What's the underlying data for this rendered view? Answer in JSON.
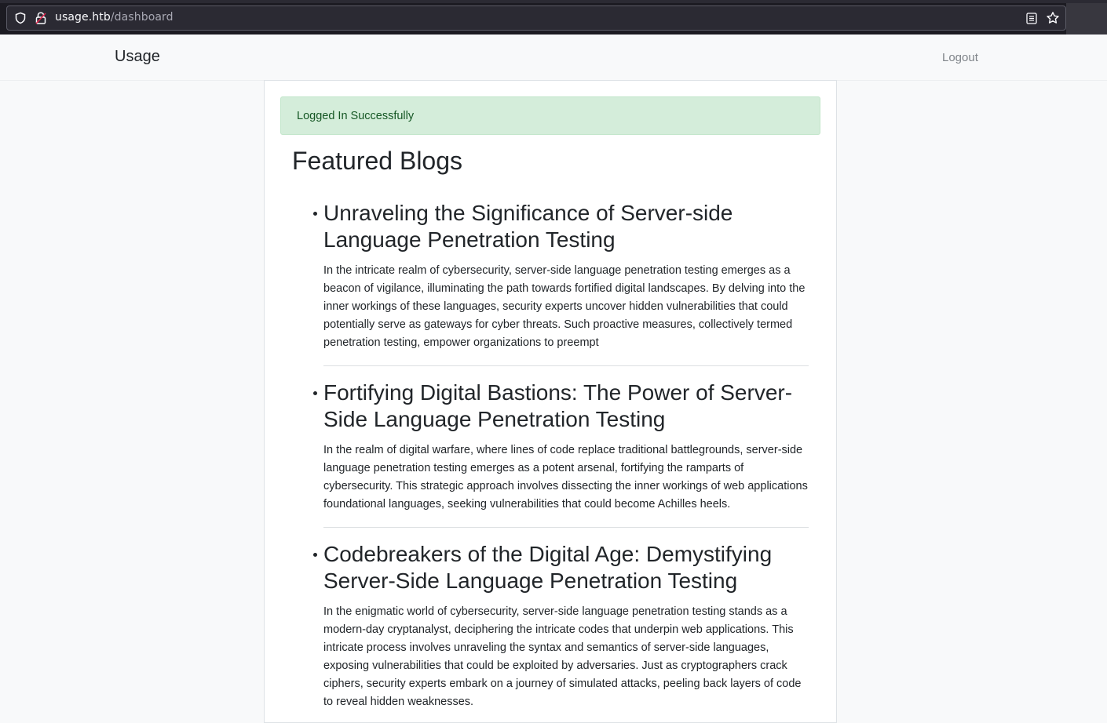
{
  "browser": {
    "url_host": "usage.htb",
    "url_path": "/dashboard"
  },
  "navbar": {
    "brand": "Usage",
    "logout_label": "Logout"
  },
  "alert": {
    "message": "Logged In Successfully"
  },
  "main": {
    "title": "Featured Blogs",
    "blogs": [
      {
        "title": "Unraveling the Significance of Server-side Language Penetration Testing",
        "body": "In the intricate realm of cybersecurity, server-side language penetration testing emerges as a beacon of vigilance, illuminating the path towards fortified digital landscapes. By delving into the inner workings of these languages, security experts uncover hidden vulnerabilities that could potentially serve as gateways for cyber threats. Such proactive measures, collectively termed penetration testing, empower organizations to preempt"
      },
      {
        "title": "Fortifying Digital Bastions: The Power of Server-Side Language Penetration Testing",
        "body": "In the realm of digital warfare, where lines of code replace traditional battlegrounds, server-side language penetration testing emerges as a potent arsenal, fortifying the ramparts of cybersecurity. This strategic approach involves dissecting the inner workings of web applications foundational languages, seeking vulnerabilities that could become Achilles heels."
      },
      {
        "title": "Codebreakers of the Digital Age: Demystifying Server-Side Language Penetration Testing",
        "body": "In the enigmatic world of cybersecurity, server-side language penetration testing stands as a modern-day cryptanalyst, deciphering the intricate codes that underpin web applications. This intricate process involves unraveling the syntax and semantics of server-side languages, exposing vulnerabilities that could be exploited by adversaries. Just as cryptographers crack ciphers, security experts embark on a journey of simulated attacks, peeling back layers of code to reveal hidden weaknesses."
      }
    ]
  },
  "colors": {
    "alert_bg": "#d4edda",
    "alert_text": "#155724",
    "navbar_bg": "#f8f9fa"
  }
}
